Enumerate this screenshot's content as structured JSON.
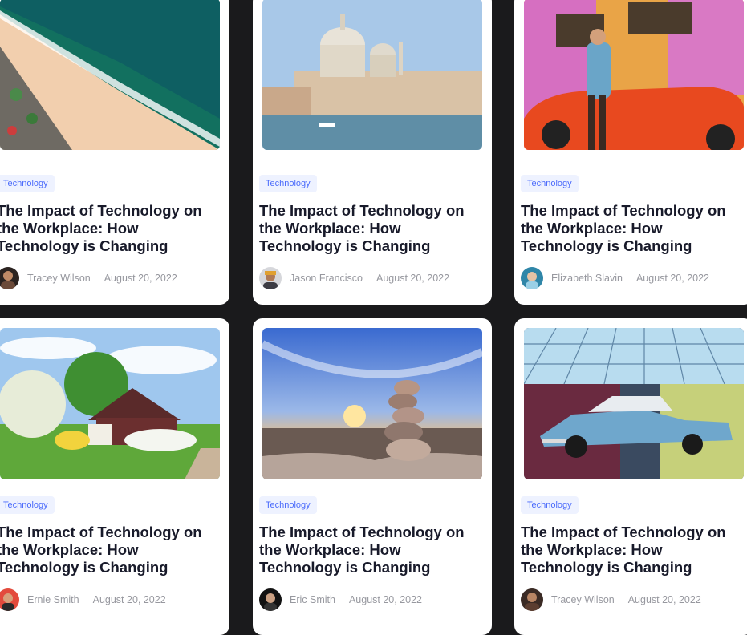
{
  "cards": [
    {
      "category": "Technology",
      "title": "The Impact of Technology on the Workplace: How Technology is Changing",
      "author": "Tracey Wilson",
      "date": "August 20, 2022"
    },
    {
      "category": "Technology",
      "title": "The Impact of Technology on the Workplace: How Technology is Changing",
      "author": "Jason Francisco",
      "date": "August 20, 2022"
    },
    {
      "category": "Technology",
      "title": "The Impact of Technology on the Workplace: How Technology is Changing",
      "author": "Elizabeth Slavin",
      "date": "August 20, 2022"
    },
    {
      "category": "Technology",
      "title": "The Impact of Technology on the Workplace: How Technology is Changing",
      "author": "Ernie Smith",
      "date": "August 20, 2022"
    },
    {
      "category": "Technology",
      "title": "The Impact of Technology on the Workplace: How Technology is Changing",
      "author": "Eric Smith",
      "date": "August 20, 2022"
    },
    {
      "category": "Technology",
      "title": "The Impact of Technology on the Workplace: How Technology is Changing",
      "author": "Tracey Wilson",
      "date": "August 20, 2022"
    }
  ],
  "colors": {
    "badge_text": "#4b6bfb",
    "badge_bg": "#eef2ff",
    "title": "#181a2a",
    "meta": "#97989f",
    "page_bg": "#1a1a1c"
  }
}
